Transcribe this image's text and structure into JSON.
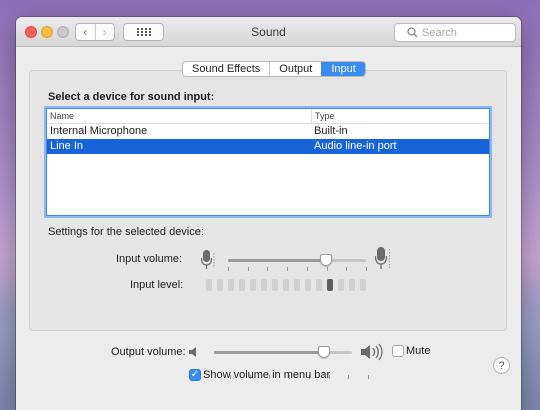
{
  "window": {
    "title": "Sound",
    "nav_back": "‹",
    "nav_forward": "›"
  },
  "search": {
    "placeholder": "Search",
    "value": ""
  },
  "tabs": [
    {
      "label": "Sound Effects",
      "selected": false
    },
    {
      "label": "Output",
      "selected": false
    },
    {
      "label": "Input",
      "selected": true
    }
  ],
  "input_panel": {
    "heading": "Select a device for sound input:",
    "columns": [
      "Name",
      "Type"
    ],
    "devices": [
      {
        "name": "Internal Microphone",
        "type": "Built-in",
        "selected": false
      },
      {
        "name": "Line In",
        "type": "Audio line-in port",
        "selected": true
      }
    ],
    "settings_label": "Settings for the selected device:",
    "input_volume_label": "Input volume:",
    "input_volume_level": 0.71,
    "input_level_label": "Input level:",
    "input_level_cells": 15,
    "input_level_active_cell": 12,
    "help": "?"
  },
  "output": {
    "volume_label": "Output volume:",
    "volume_level": 0.8,
    "mute_label": "Mute",
    "mute_checked": false,
    "show_volume_label": "Show volume in menu bar",
    "show_volume_checked": true
  },
  "colors": {
    "accent": "#3b8cf0",
    "selection": "#1764d8"
  }
}
